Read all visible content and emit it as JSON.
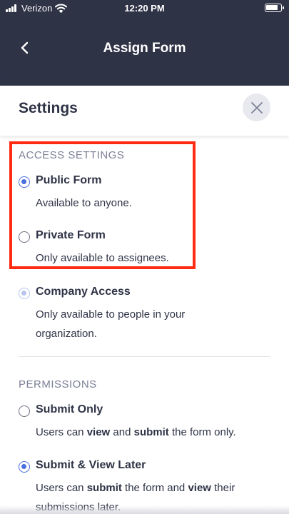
{
  "status_bar": {
    "carrier": "Verizon",
    "time": "12:20 PM"
  },
  "nav": {
    "title": "Assign Form",
    "back_icon": "chevron-left-icon"
  },
  "settings": {
    "title": "Settings",
    "close_icon": "close-icon"
  },
  "access": {
    "label": "ACCESS SETTINGS",
    "public": {
      "title": "Public Form",
      "desc": "Available to anyone.",
      "selected": true
    },
    "private": {
      "title": "Private Form",
      "desc": "Only available to assignees.",
      "selected": false
    },
    "company": {
      "title": "Company Access",
      "desc": "Only available to people in your organization.",
      "selected": true,
      "disabled": true
    }
  },
  "permissions": {
    "label": "PERMISSIONS",
    "submit_only": {
      "title": "Submit Only",
      "desc_1": "Users can ",
      "desc_bold_1": "view",
      "desc_2": " and ",
      "desc_bold_2": "submit",
      "desc_3": " the form only.",
      "selected": false
    },
    "submit_view": {
      "title": "Submit & View Later",
      "desc_1": "Users can ",
      "desc_bold_1": "submit",
      "desc_2": " the form and ",
      "desc_bold_2": "view",
      "desc_3": " their submissions later.",
      "selected": true
    }
  },
  "colors": {
    "header": "#2f3346",
    "accent": "#4a6fde",
    "highlight": "#ff2a12"
  }
}
